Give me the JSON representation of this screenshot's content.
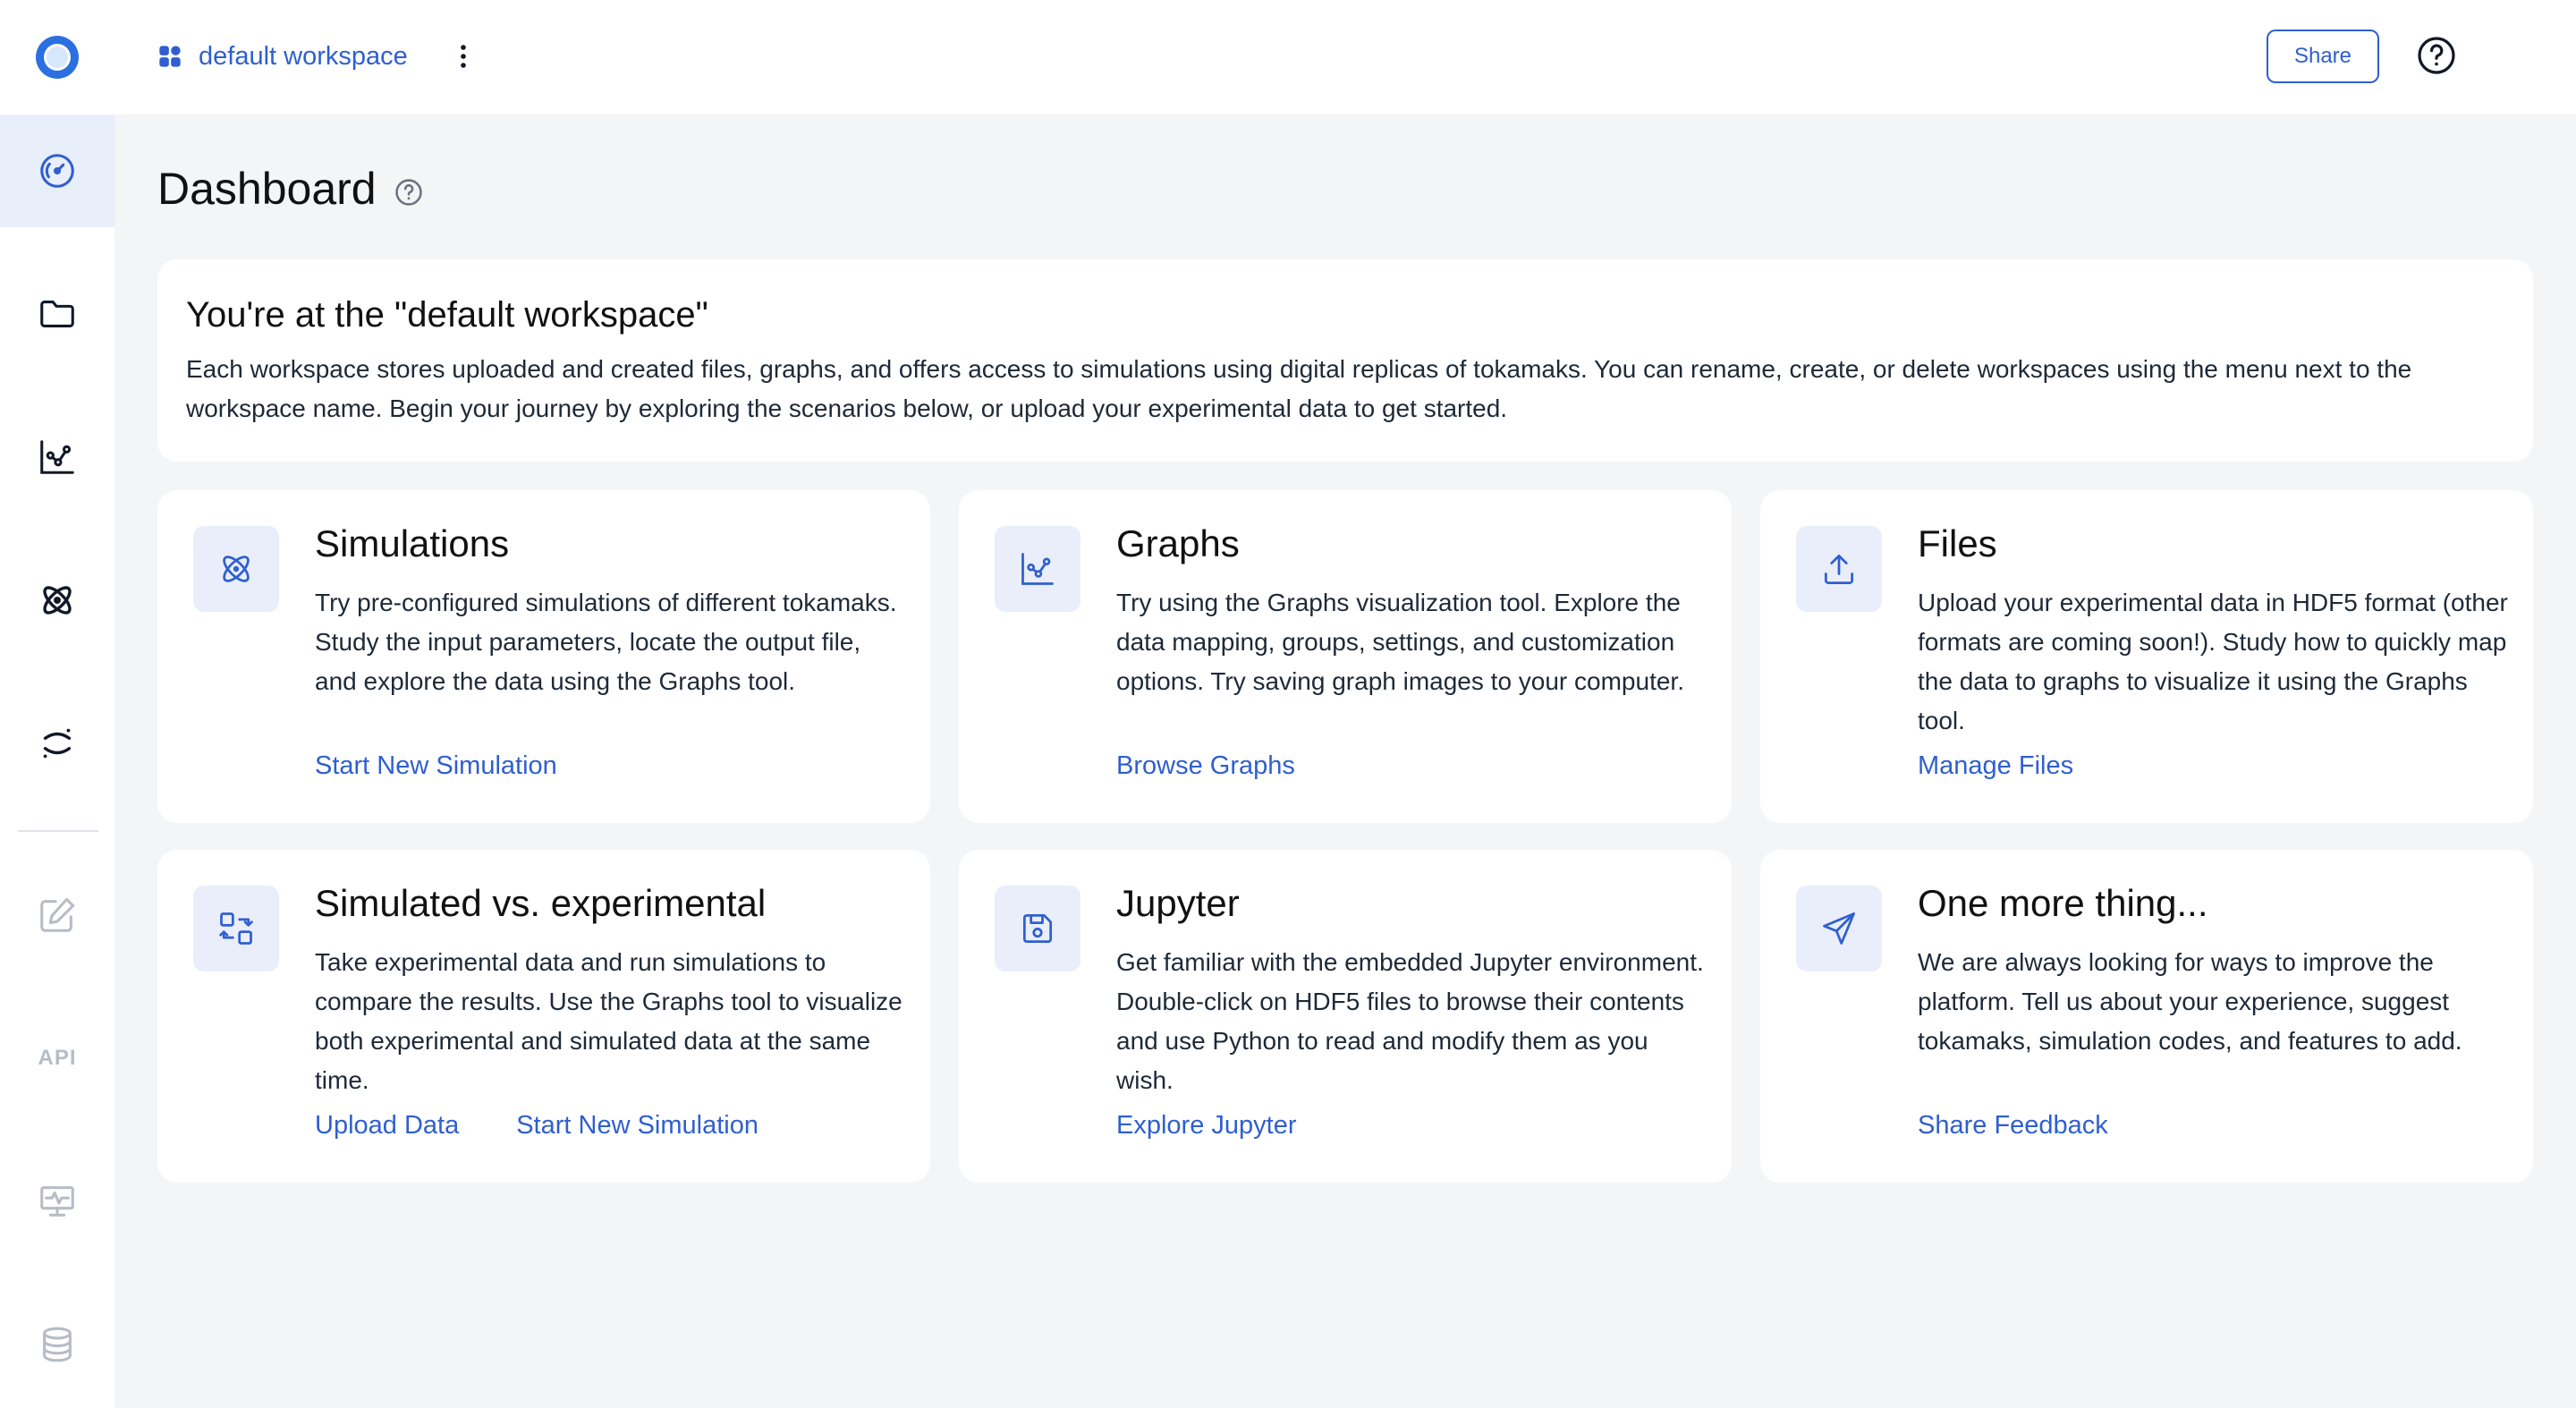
{
  "header": {
    "workspace_name": "default workspace",
    "share_label": "Share"
  },
  "sidebar": {
    "items": [
      {
        "name": "dashboard",
        "icon": "gauge-icon",
        "active": true
      },
      {
        "name": "files",
        "icon": "folder-icon"
      },
      {
        "name": "graphs",
        "icon": "chart-icon"
      },
      {
        "name": "simulations",
        "icon": "atom-icon"
      },
      {
        "name": "jupyter",
        "icon": "jupyter-icon"
      },
      {
        "name": "notes",
        "icon": "edit-icon"
      },
      {
        "name": "api",
        "label": "API"
      },
      {
        "name": "monitor",
        "icon": "monitor-icon"
      },
      {
        "name": "database",
        "icon": "database-icon"
      }
    ]
  },
  "page": {
    "title": "Dashboard"
  },
  "intro": {
    "heading": "You're at the \"default workspace\"",
    "text": "Each workspace stores uploaded and created files, graphs, and offers access to simulations using digital replicas of tokamaks. You can rename, create, or delete workspaces using the menu next to the workspace name. Begin your journey by exploring the scenarios below, or upload your experimental data to get started."
  },
  "cards": {
    "simulations": {
      "title": "Simulations",
      "text": "Try pre-configured simulations of different tokamaks. Study the input parameters, locate the output file, and explore the data using the Graphs tool.",
      "link1": "Start New Simulation"
    },
    "graphs": {
      "title": "Graphs",
      "text": "Try using the Graphs visualization tool. Explore the data mapping, groups, settings, and customization options. Try saving graph images to your computer.",
      "link1": "Browse Graphs"
    },
    "files": {
      "title": "Files",
      "text": "Upload your experimental data in HDF5 format (other formats are coming soon!). Study how to quickly map the data to graphs to visualize it using the Graphs tool.",
      "link1": "Manage Files"
    },
    "simexp": {
      "title": "Simulated vs. experimental",
      "text": "Take experimental data and run simulations to compare the results. Use the Graphs tool to visualize both experimental and simulated data at the same time.",
      "link1": "Upload Data",
      "link2": "Start New Simulation"
    },
    "jupyter": {
      "title": "Jupyter",
      "text": "Get familiar with the embedded Jupyter environment. Double-click on HDF5 files to browse their contents and use Python to read and modify them as you wish.",
      "link1": "Explore Jupyter"
    },
    "feedback": {
      "title": "One more thing...",
      "text": "We are always looking for ways to improve the platform. Tell us about your experience, suggest tokamaks, simulation codes, and features to add.",
      "link1": "Share Feedback"
    }
  },
  "colors": {
    "accent": "#2f5fd0",
    "icon_bg": "#e9eefa",
    "page_bg": "#f4f5f7"
  }
}
